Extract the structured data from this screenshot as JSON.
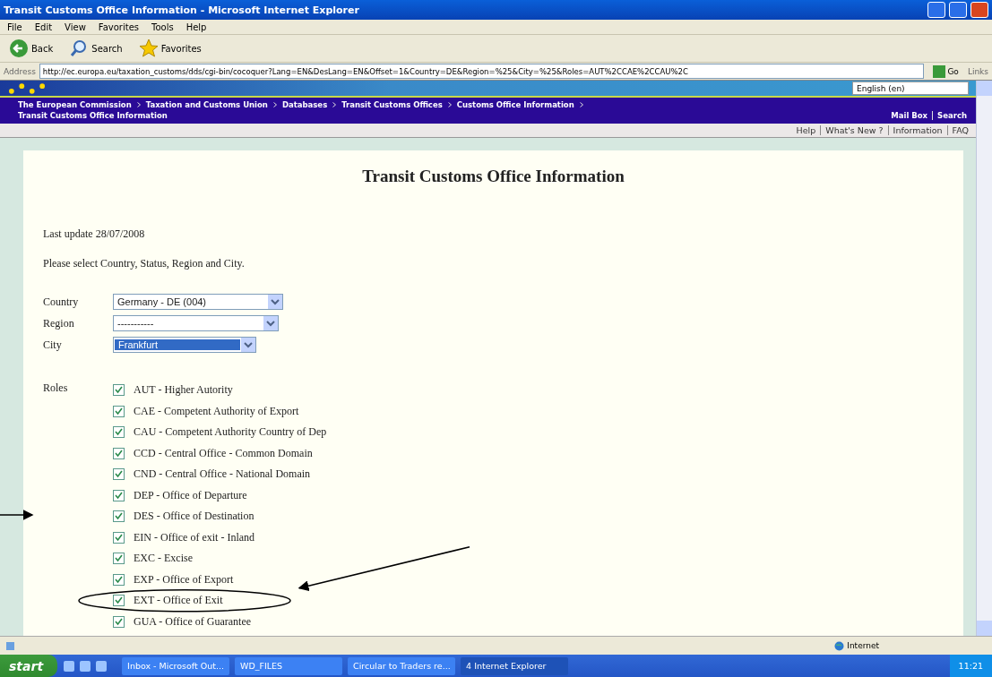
{
  "window": {
    "title": "Transit Customs Office Information - Microsoft Internet Explorer"
  },
  "menu": [
    "File",
    "Edit",
    "View",
    "Favorites",
    "Tools",
    "Help"
  ],
  "toolbar": [
    {
      "kind": "back",
      "label": "Back"
    },
    {
      "kind": "search",
      "label": "Search"
    },
    {
      "kind": "favorites",
      "label": "Favorites"
    }
  ],
  "address": {
    "label": "Address",
    "value": "http://ec.europa.eu/taxation_customs/dds/cgi-bin/cocoquer?Lang=EN&DesLang=EN&Offset=1&Country=DE&Region=%25&City=%25&Roles=AUT%2CCAE%2CCAU%2C",
    "go": "Go",
    "links": "Links"
  },
  "banner": {
    "language": "English (en)"
  },
  "breadcrumb": [
    "The European Commission",
    "Taxation and Customs Union",
    "Databases",
    "Transit Customs Offices",
    "Customs Office Information",
    "Transit Customs Office Information"
  ],
  "top_links": [
    "Mail Box",
    "Search"
  ],
  "help_links": [
    "Help",
    "What's New ?",
    "Information",
    "FAQ"
  ],
  "page": {
    "title": "Transit Customs Office Information",
    "last_update": "Last update 28/07/2008",
    "instruction": "Please select Country, Status, Region and City.",
    "fields": [
      {
        "label": "Country",
        "value": "Germany - DE (004)",
        "focused": false
      },
      {
        "label": "Region",
        "value": "-----------",
        "focused": false
      },
      {
        "label": "City",
        "value": "Frankfurt",
        "focused": true
      }
    ],
    "roles_label": "Roles",
    "roles": [
      {
        "label": "AUT - Higher Autority",
        "checked": true
      },
      {
        "label": "CAE - Competent Authority of Export",
        "checked": true
      },
      {
        "label": "CAU - Competent Authority Country of Dep",
        "checked": true
      },
      {
        "label": "CCD - Central Office - Common Domain",
        "checked": true
      },
      {
        "label": "CND - Central Office - National Domain",
        "checked": true
      },
      {
        "label": "DEP - Office of Departure",
        "checked": true
      },
      {
        "label": "DES - Office of Destination",
        "checked": true
      },
      {
        "label": "EIN - Office of exit - Inland",
        "checked": true
      },
      {
        "label": "EXC - Excise",
        "checked": true
      },
      {
        "label": "EXP - Office of Export",
        "checked": true
      },
      {
        "label": "EXT - Office of Exit",
        "checked": true
      },
      {
        "label": "GUA - Office of Guarantee",
        "checked": true
      }
    ]
  },
  "status_bar": {
    "zone": "Internet"
  },
  "taskbar": {
    "start": "start",
    "items": [
      {
        "label": "Inbox - Microsoft Out...",
        "selected": false
      },
      {
        "label": "WD_FILES",
        "selected": false
      },
      {
        "label": "Circular to Traders re...",
        "selected": false
      },
      {
        "label": "4 Internet Explorer",
        "selected": true
      }
    ],
    "clock": "11:21"
  }
}
